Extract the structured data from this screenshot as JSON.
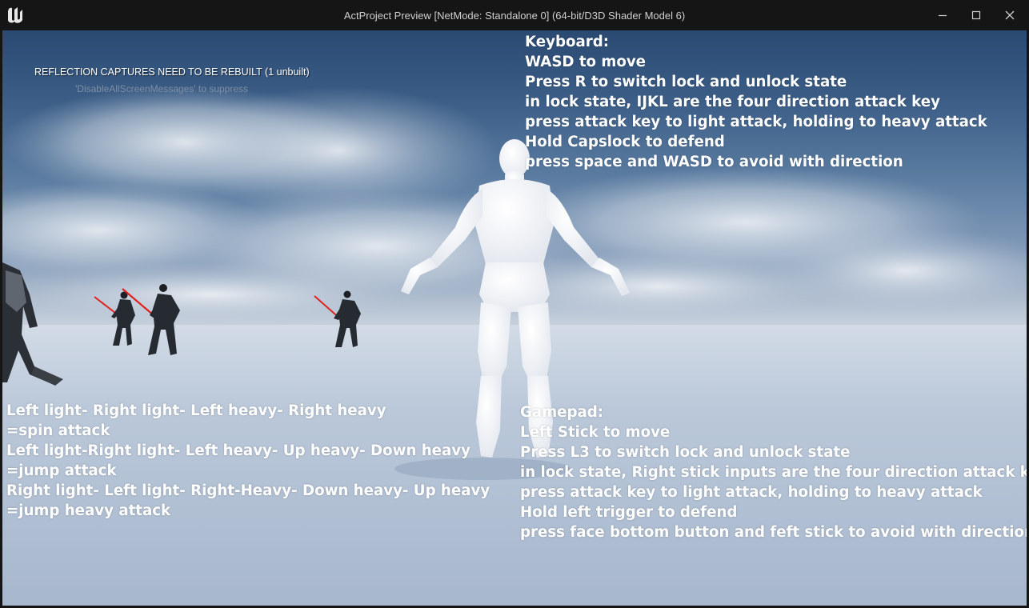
{
  "window": {
    "title": "ActProject Preview [NetMode: Standalone 0]  (64-bit/D3D Shader Model 6)",
    "controls": {
      "minimize": "minimize-icon",
      "maximize": "maximize-icon",
      "close": "close-icon"
    },
    "logo_icon": "unreal-engine-logo-icon"
  },
  "screen_messages": {
    "warning": "REFLECTION CAPTURES NEED TO BE REBUILT (1 unbuilt)",
    "hint": "'DisableAllScreenMessages' to suppress"
  },
  "keyboard_help": {
    "lines": [
      "Keyboard:",
      "WASD to move",
      "Press R to switch lock and unlock state",
      "in lock state, IJKL are the four direction attack key",
      "press attack key to light attack, holding to heavy attack",
      "Hold Capslock to defend",
      "press space and WASD to avoid with direction"
    ]
  },
  "gamepad_help": {
    "lines": [
      "Gamepad:",
      "Left Stick to move",
      "Press L3 to switch lock and unlock state",
      "in lock state, Right stick inputs are the four direction attack key",
      "press attack key to light attack, holding to heavy attack",
      "Hold left trigger to defend",
      "press face bottom button and feft stick to avoid with direction"
    ]
  },
  "combo_help": {
    "lines": [
      "Left light- Right light- Left heavy- Right heavy",
      "=spin attack",
      "Left light-Right light- Left heavy- Up heavy- Down heavy",
      "=jump attack",
      "Right light- Left light- Right-Heavy- Down heavy- Up heavy",
      "=jump heavy attack"
    ]
  },
  "colors": {
    "titlebar": "#151515",
    "overlay_text": "#ffffff",
    "saber": "#e0221c",
    "mannequin": "#f1f3f7"
  }
}
